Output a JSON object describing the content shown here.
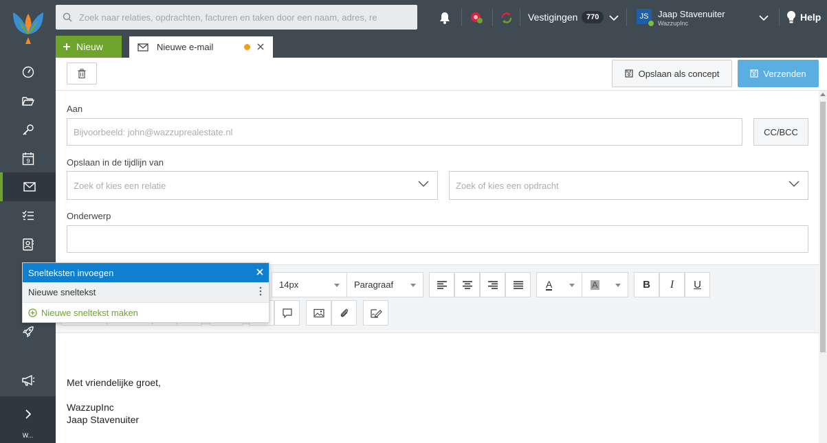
{
  "topbar": {
    "search_placeholder": "Zoek naar relaties, opdrachten, facturen en taken door een naam, adres, re",
    "vestigingen_label": "Vestigingen",
    "vestigingen_count": "770",
    "user_initials": "JS",
    "user_name": "Jaap Stavenuiter",
    "user_org": "WazzupInc",
    "help_label": "Help"
  },
  "tabs": {
    "new_label": "Nieuw",
    "active_tab_label": "Nieuwe e-mail"
  },
  "sidebar": {
    "items": [
      {
        "icon": "dashboard-icon"
      },
      {
        "icon": "folder-icon"
      },
      {
        "icon": "key-icon"
      },
      {
        "icon": "calendar-icon",
        "text": "9"
      },
      {
        "icon": "mail-icon"
      },
      {
        "icon": "tasks-icon"
      },
      {
        "icon": "contacts-icon"
      },
      {
        "icon": "rocket-icon"
      },
      {
        "icon": "megaphone-icon"
      }
    ],
    "bottom_text": "W..."
  },
  "actions": {
    "save_draft_label": "Opslaan als concept",
    "send_label": "Verzenden"
  },
  "form": {
    "to_label": "Aan",
    "to_placeholder": "Bijvoorbeeld: john@wazzuprealestate.nl",
    "ccbcc_label": "CC/BCC",
    "timeline_label": "Opslaan in de tijdlijn van",
    "relation_placeholder": "Zoek of kies een relatie",
    "assignment_placeholder": "Zoek of kies een opdracht",
    "subject_label": "Onderwerp",
    "subject_value": ""
  },
  "editor": {
    "font_size": "14px",
    "block_format": "Paragraaf",
    "text_color_label": "A",
    "bg_color_label": "A",
    "bold_label": "B",
    "italic_label": "I",
    "underline_label": "U"
  },
  "snippets_popover": {
    "title": "Snelteksten invoegen",
    "item_label": "Nieuwe sneltekst",
    "new_label": "Nieuwe sneltekst maken"
  },
  "body": {
    "greeting": "Met vriendelijke groet,",
    "company": "WazzupInc",
    "name": "Jaap Stavenuiter"
  },
  "colors": {
    "sidebar": "#3f4a52",
    "accent_green": "#6ea42c",
    "send_blue": "#5aaee0",
    "popover_blue": "#0f7fd0",
    "tab_dot": "#f0a01a"
  }
}
